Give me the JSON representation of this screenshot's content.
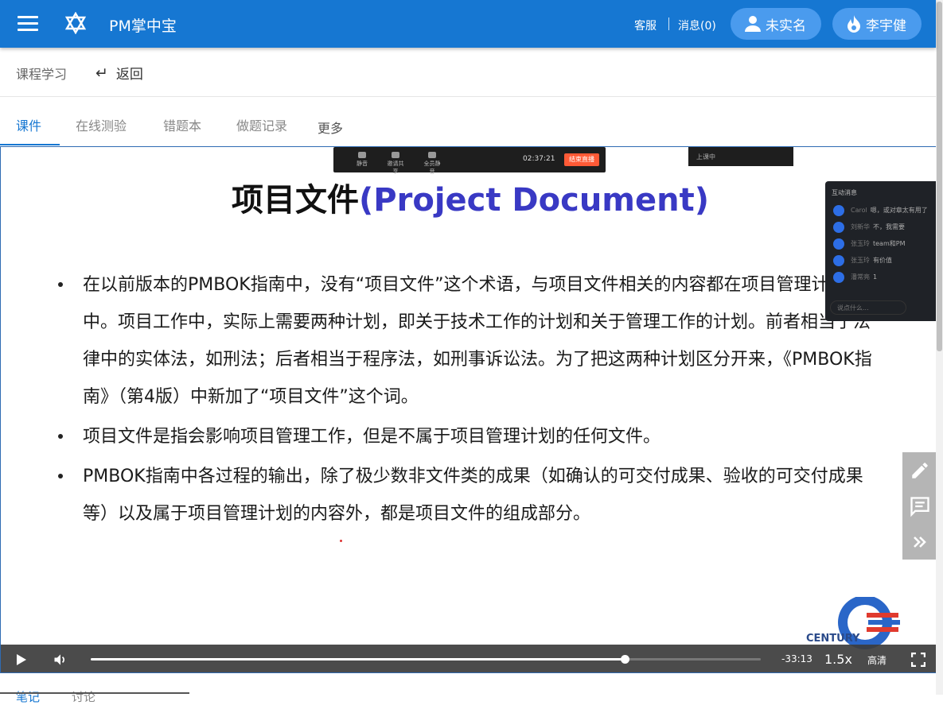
{
  "header": {
    "app_title": "PM掌中宝",
    "service_label": "客服",
    "messages_label": "消息(0)",
    "verify_label": "未实名",
    "user_name": "李宇健",
    "brand_color": "#1677d2"
  },
  "subbar": {
    "breadcrumb": "课程学习",
    "back_arrow": "↵",
    "back_label": "返回"
  },
  "tabs": [
    {
      "label": "课件",
      "active": true
    },
    {
      "label": "在线测验",
      "active": false
    },
    {
      "label": "错题本",
      "active": false
    },
    {
      "label": "做题记录",
      "active": false
    },
    {
      "label": "更多",
      "active": false
    }
  ],
  "stream": {
    "time": "02:37:21",
    "end_button": "结束直播",
    "items": [
      "静音",
      "邀请共享",
      "全员静音"
    ],
    "live_status": "上课中"
  },
  "slide": {
    "title_cn": "项目文件",
    "title_en": "(Project Document)",
    "bullets": [
      "在以前版本的PMBOK指南中，没有“项目文件”这个术语，与项目文件相关的内容都在项目管理计划中。项目工作中，实际上需要两种计划，即关于技术工作的计划和关于管理工作的计划。前者相当于法律中的实体法，如刑法；后者相当于程序法，如刑事诉讼法。为了把这两种计划区分开来，《PMBOK指南》（第4版）中新加了“项目文件”这个词。",
      "项目文件是指会影响项目管理工作，但是不属于项目管理计划的任何文件。",
      "PMBOK指南中各过程的输出，除了极少数非文件类的成果（如确认的可交付成果、验收的可交付成果等）以及属于项目管理计划的内容外，都是项目文件的组成部分。"
    ],
    "corner_logo_text": "CENTURY"
  },
  "chat": {
    "header": "互动消息",
    "messages": [
      {
        "name": "Carol",
        "text": "嗯，或对章太有用了"
      },
      {
        "name": "刘新华",
        "text": "不，我需要"
      },
      {
        "name": "张玉玲",
        "text": "team和PM"
      },
      {
        "name": "张玉玲",
        "text": "有价值"
      },
      {
        "name": "潘常亮",
        "text": "1"
      }
    ],
    "input_placeholder": "说点什么..."
  },
  "player": {
    "progress_fraction": 0.797,
    "time_remaining": "-33:13",
    "speed": "1.5x",
    "quality": "高清"
  },
  "bottom_tabs": [
    "笔记",
    "讨论"
  ]
}
